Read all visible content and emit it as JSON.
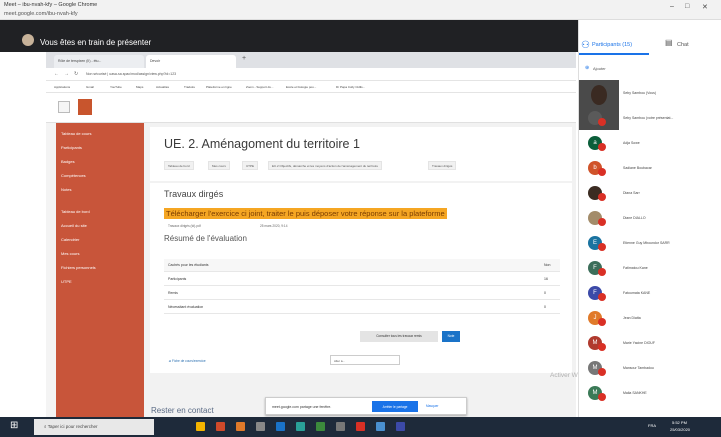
{
  "window": {
    "title": "Meet – ibu-nvah-kfy – Google Chrome",
    "url": "meet.google.com/ibu-nvah-kfy"
  },
  "meet": {
    "presenting_text": "Vous êtes en train de présenter",
    "participants_tab": "Participants (15)",
    "chat_tab": "Chat",
    "add_label": "Ajouter",
    "participants": [
      {
        "name": "Seby Sambou (Vous)",
        "initial": "",
        "color": "#6b4f3b"
      },
      {
        "name": "Seby Sambou (votre présentat...",
        "initial": "",
        "color": "#5a5a5a"
      },
      {
        "name": "Adja Sowe",
        "initial": "a",
        "color": "#0b5e3a"
      },
      {
        "name": "Sadiane Boubacar",
        "initial": "b",
        "color": "#d0532a"
      },
      {
        "name": "Diana Sarr",
        "initial": "",
        "color": "#3b2c22"
      },
      {
        "name": "Diane DIALLO",
        "initial": "",
        "color": "#a38c6a"
      },
      {
        "name": "Etienne Guy Mboundor SARR",
        "initial": "E",
        "color": "#1a73a0"
      },
      {
        "name": "Fatimatou Kane",
        "initial": "F",
        "color": "#3c6e5a"
      },
      {
        "name": "Fatoumata KANE",
        "initial": "F",
        "color": "#3c4aa8"
      },
      {
        "name": "Jean Diatta",
        "initial": "J",
        "color": "#e07a2a"
      },
      {
        "name": "Marie Yacine DIOUF",
        "initial": "M",
        "color": "#b03a2e"
      },
      {
        "name": "Mansour Tambadou",
        "initial": "M",
        "color": "#777777"
      },
      {
        "name": "Malia SANKHE",
        "initial": "M",
        "color": "#3b7a57"
      }
    ]
  },
  "inner": {
    "tabs": [
      "Rôle de terspixen (II) - étu...",
      "Devoir"
    ],
    "address": "Non sécurisé | uasa-sa.spac/mod/assign/view.php?id=123",
    "bookmarks": [
      "Applications",
      "Gmail",
      "YouTube",
      "Maps",
      "Actualités",
      "Traduire",
      "Plateforme en ligne",
      "Zoom - Support du...",
      "Ecole et biologie pou...",
      "Dr Papa Colly Cidils..."
    ],
    "sidebar": [
      "Tableau de cours",
      "Participants",
      "Badges",
      "Compétences",
      "Notes",
      "Tableau de bord",
      "Accueil du site",
      "Calendrier",
      "Mes cours",
      "Fichiers personnels",
      "UTPE"
    ],
    "course_title": "UE. 2. Aménagoment du territoire 1",
    "crumbs": [
      "Tableau de bord",
      "Mes cours",
      "UTPE",
      "EC.2 Objectifs, démarche et les moyens d'action de l'aménagement du territoire",
      "Travaux dirigés"
    ],
    "section_title": "Travaux dirgés",
    "highlight": "Télécharger l'exercice ci joint, traiter le puis déposer votre réponse sur la plateforme",
    "meta_author": "Travaux dirigés (td).pdf",
    "meta_date": "25 mars 2020, 9:14",
    "summary_title": "Résumé de l'évaluation",
    "table_header": [
      "Cachés pour les étudiants",
      "Non"
    ],
    "table_rows": [
      [
        "Participants",
        "16"
      ],
      [
        "Remis",
        "0"
      ],
      [
        "Nécessitant évaluation",
        "0"
      ]
    ],
    "btn_view": "Consulter tous les travaux remis",
    "btn_grade": "Note",
    "nav_prev": "◄ Fiche de cours/exercice",
    "nav_select": "Aller à...",
    "contact_title": "Rester en contact",
    "watermark": "Activer Windows"
  },
  "notification": {
    "text": "meet.google.com partage une fenêtre.",
    "stop_label": "Arrêter le partage",
    "hide_label": "Masquer"
  },
  "taskbar": {
    "search_placeholder": "Taper ici pour rechercher",
    "time": "5:52 PM",
    "date": "25/03/2020",
    "lang": "FRA"
  }
}
